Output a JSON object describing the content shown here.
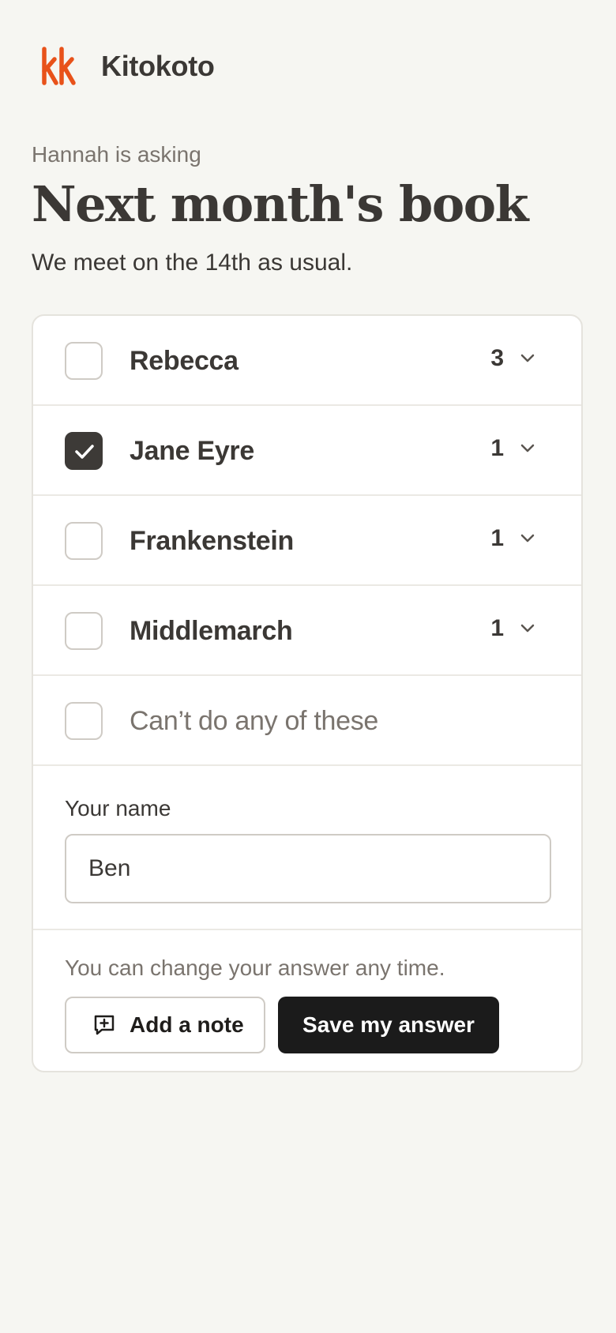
{
  "app": {
    "name": "Kitokoto",
    "brand_color": "#e8521a"
  },
  "poll": {
    "asker": "Hannah is asking",
    "title": "Next month's book",
    "description": "We meet on the 14th as usual."
  },
  "options": [
    {
      "label": "Rebecca",
      "count": "3",
      "checked": false
    },
    {
      "label": "Jane Eyre",
      "count": "1",
      "checked": true
    },
    {
      "label": "Frankenstein",
      "count": "1",
      "checked": false
    },
    {
      "label": "Middlemarch",
      "count": "1",
      "checked": false
    }
  ],
  "none_option": {
    "label": "Can’t do any of these",
    "checked": false
  },
  "name_field": {
    "label": "Your name",
    "value": "Ben"
  },
  "footer": {
    "hint": "You can change your answer any time.",
    "add_note_label": "Add a note",
    "add_note_icon": "message-plus-icon",
    "save_label": "Save my answer"
  }
}
